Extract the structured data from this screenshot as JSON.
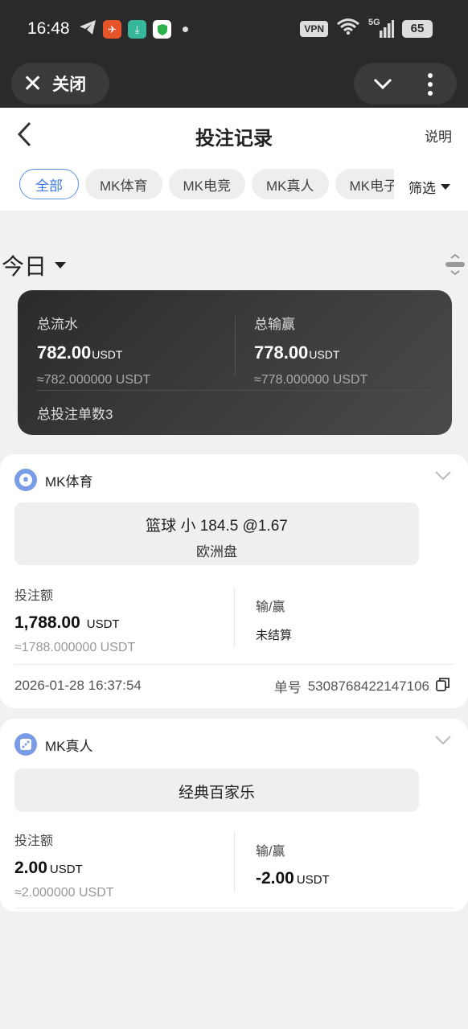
{
  "status_bar": {
    "time": "16:48",
    "vpn": "VPN",
    "network": "5G",
    "battery": "65",
    "app_icons": [
      "telegram-icon",
      "orange-app-icon",
      "download-app-icon",
      "shield-app-icon"
    ]
  },
  "browser": {
    "close_label": "关闭"
  },
  "header": {
    "title": "投注记录",
    "explain": "说明",
    "filter": "筛选"
  },
  "tabs": [
    "全部",
    "MK体育",
    "MK电竞",
    "MK真人",
    "MK电子"
  ],
  "date_selector": "今日",
  "summary": {
    "turnover_label": "总流水",
    "turnover_value": "782.00",
    "turnover_unit": "USDT",
    "turnover_approx": "≈782.000000 USDT",
    "winloss_label": "总输赢",
    "winloss_value": "778.00",
    "winloss_unit": "USDT",
    "winloss_approx": "≈778.000000 USDT",
    "count_text": "总投注单数3"
  },
  "bets": [
    {
      "provider": "MK体育",
      "pick": "篮球 小 184.5 @1.67",
      "pick_sub": "欧洲盘",
      "amount_label": "投注额",
      "amount": "1,788.00",
      "amount_unit": "USDT",
      "amount_approx": "≈1788.000000 USDT",
      "winloss_label": "输/赢",
      "winloss": "未结算",
      "time": "2026-01-28 16:37:54",
      "order_label": "单号",
      "order_no": "5308768422147106"
    },
    {
      "provider": "MK真人",
      "pick": "经典百家乐",
      "amount_label": "投注额",
      "amount": "2.00",
      "amount_unit": "USDT",
      "amount_approx": "≈2.000000 USDT",
      "winloss_label": "输/赢",
      "winloss": "-2.00",
      "winloss_unit": "USDT"
    }
  ]
}
